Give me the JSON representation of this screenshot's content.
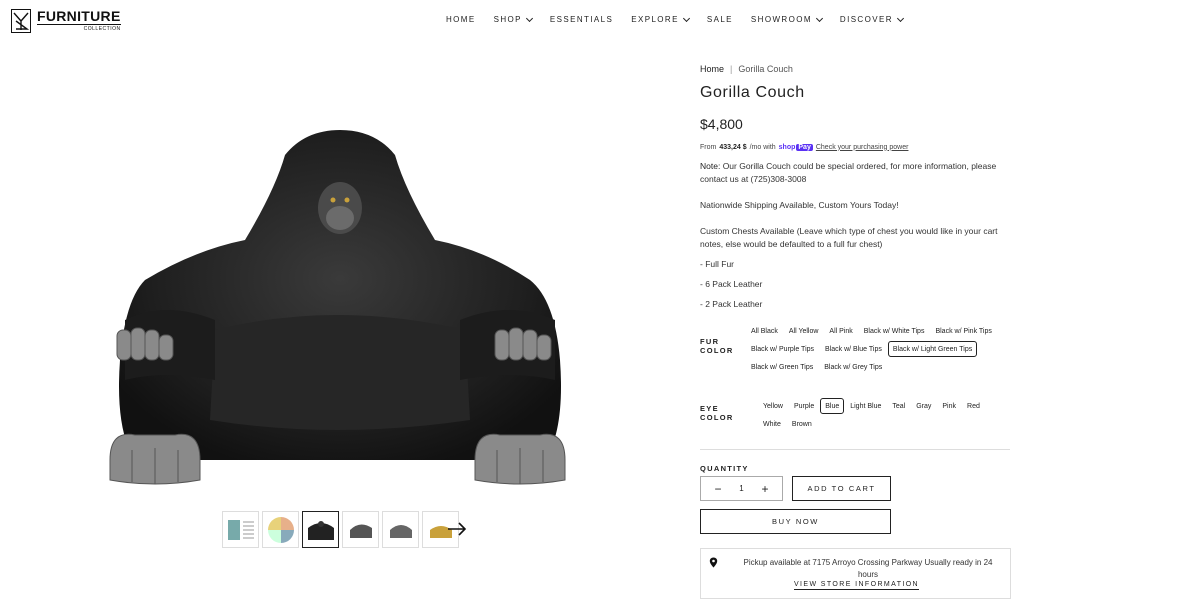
{
  "brand": {
    "name": "FURNITURE",
    "sub": "COLLECTION",
    "logo_icon": "yz-monogram-icon"
  },
  "nav": [
    {
      "label": "HOME",
      "dropdown": false
    },
    {
      "label": "SHOP",
      "dropdown": true
    },
    {
      "label": "ESSENTIALS",
      "dropdown": false
    },
    {
      "label": "EXPLORE",
      "dropdown": true
    },
    {
      "label": "SALE",
      "dropdown": false
    },
    {
      "label": "SHOWROOM",
      "dropdown": true
    },
    {
      "label": "DISCOVER",
      "dropdown": true
    }
  ],
  "breadcrumb": {
    "home": "Home",
    "separator": "|",
    "current": "Gorilla Couch"
  },
  "product": {
    "title": "Gorilla Couch",
    "price": "$4,800",
    "installments": {
      "prefix": "From",
      "amount": "433,24 $",
      "suffix": "/mo with",
      "shoppay": "shop",
      "shoppay_badge": "Pay",
      "link": "Check your purchasing power"
    },
    "note_label": "Note:",
    "note_text": " Our Gorilla Couch could be special ordered, for more information, please contact us at (725)308-3008",
    "shipping": "Nationwide Shipping Available, Custom Yours Today!",
    "chests": "Custom Chests Available (Leave which type of chest you would like in your cart notes, else would be defaulted to a full fur chest)",
    "chest_options": [
      "- Full Fur",
      "- 6 Pack Leather",
      "- 2 Pack Leather"
    ]
  },
  "fur_color": {
    "label_line1": "FUR",
    "label_line2": "COLOR",
    "options": [
      "All Black",
      "All Yellow",
      "All Pink",
      "Black w/ White Tips",
      "Black w/ Pink Tips",
      "Black w/ Purple Tips",
      "Black w/ Blue Tips",
      "Black w/ Light Green Tips",
      "Black w/ Green Tips",
      "Black w/ Grey Tips"
    ],
    "selected": "Black w/ Light Green Tips"
  },
  "eye_color": {
    "label_line1": "EYE",
    "label_line2": "COLOR",
    "options": [
      "Yellow",
      "Purple",
      "Blue",
      "Light Blue",
      "Teal",
      "Gray",
      "Pink",
      "Red",
      "White",
      "Brown"
    ],
    "selected": "Blue"
  },
  "quantity": {
    "label": "QUANTITY",
    "value": "1",
    "minus": "−",
    "plus": "+"
  },
  "buttons": {
    "add_to_cart": "ADD TO CART",
    "buy_now": "BUY NOW"
  },
  "pickup": {
    "text": "Pickup available at 7175 Arroyo Crossing Parkway Usually ready in 24 hours",
    "link": "VIEW STORE INFORMATION",
    "icon": "map-pin-icon"
  },
  "gallery": {
    "thumb_count": 6,
    "active_index": 2,
    "next_icon": "arrow-right-icon"
  },
  "colors": {
    "accent": "#222222",
    "shoppay": "#5a31f4"
  }
}
